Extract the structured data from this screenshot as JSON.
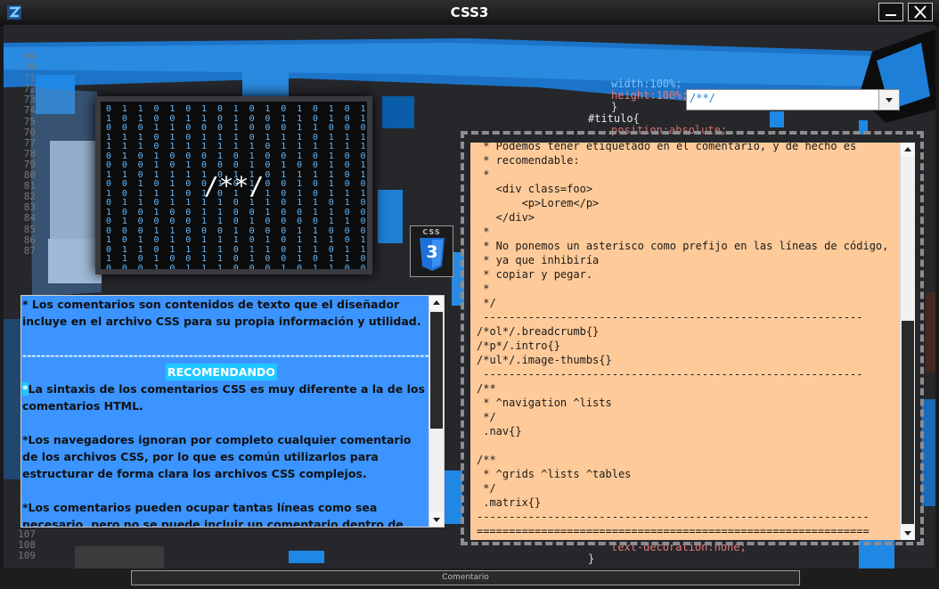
{
  "window": {
    "title": "CSS3",
    "app_icon": "z-logo-icon",
    "minimize_icon": "minimize-icon",
    "close_icon": "close-icon"
  },
  "background": {
    "line_numbers_top": [
      "69",
      "70",
      "71",
      "72",
      "73",
      "74",
      "75",
      "76",
      "77",
      "78",
      "79",
      "80",
      "81",
      "82",
      "83",
      "84",
      "85",
      "86",
      "87"
    ],
    "line_numbers_bottom": [
      "107",
      "108",
      "109"
    ],
    "code_top_right": [
      "width:100%;",
      "height:100%;",
      "}",
      "#titulo{",
      "position:absolute;"
    ],
    "code_bottom_right": [
      "text-decoration:none;",
      "}"
    ],
    "binary_rows": [
      "0 1 1 0 1 0 1 0 1 0 1 0 1 0 1 0 1 1 0 1 0",
      "1 0 1 0 0 1 1 0 1 0 0 1 1 0 1 0 1 0 0 1 1",
      "0 0 0 1 1 0 0 0 1 0 0 0 1 1 0 0 0 1 0 0 1",
      "1 1 1 0 1 0 1 1 1 0 1 1 1 0 1 1 1 0 1 0 1",
      "1 1 1 0 1 1 1 1 1 1 0 1 1 1 1 1 1 1 0 1 1",
      "0 1 0 1 0 0 0 1 0 1 0 0 1 0 1 0 0 0 1 0 1",
      "0 0 0 1 0 1 0 0 0 1 0 1 0 0 1 0 1 0 0 0 1",
      "1 1 0 1 1 1 1 0 1 1 0 1 1 1 1 0 1 1 1 0 1",
      "0 0 1 0 1 0 0 1 0 1 0 0 1 0 1 0 0 1 1 0 0",
      "1 0 1 1 1 0 1 0 1 1 1 0 1 0 1 1 1 0 1 1 0",
      "0 1 1 0 1 1 1 1 0 1 1 0 1 1 0 1 0 1 1 1 1",
      "1 0 0 1 0 0 1 1 0 0 1 0 0 1 1 0 0 1 0 0 1",
      "0 1 0 0 0 0 1 1 0 1 0 0 0 0 1 1 0 1 0 0 0",
      "0 0 0 1 1 0 0 0 1 0 0 0 1 1 0 0 0 1 0 0 0",
      "1 0 1 0 1 0 1 1 1 0 1 0 1 1 1 0 1 0 1 0 1",
      "0 1 1 0 1 1 1 1 0 1 1 0 1 1 0 1 1 1 1 0 1",
      "1 1 0 1 0 0 1 1 0 1 0 0 1 0 1 1 0 1 0 0 1",
      "0 0 0 1 0 1 1 1 0 0 0 1 0 1 1 0 0 1 0 0 0"
    ],
    "binary_overlay": "/**/",
    "css3_badge_text": "CSS",
    "css3_badge_number": "3"
  },
  "combo": {
    "value": "/**/"
  },
  "left_panel": {
    "intro": "* Los comentarios son contenidos de texto que el diseñador incluye en el archivo CSS para su propia información y utilidad.",
    "separator": "-------------------------------------------------------------------------------------------------------------",
    "heading": "RECOMENDANDO",
    "p1_star": "*",
    "p1": "La sintaxis de los comentarios CSS es muy diferente a la de los comentarios HTML.",
    "p2": "*Los navegadores ignoran por completo cualquier comentario de los archivos CSS, por lo que es común utilizarlos para estructurar de forma clara los archivos CSS complejos.",
    "p3": "*Los comentarios pueden ocupar tantas líneas como sea necesario, pero no se puede incluir un comentario dentro de otro comentario"
  },
  "right_panel": {
    "lines": [
      " * Podemos tener etiquetado en el comentario, y de hecho es",
      " * recomendable:",
      " *",
      "   <div class=foo>",
      "       <p>Lorem</p>",
      "   </div>",
      " *",
      " * No ponemos un asterisco como prefijo en las líneas de código,",
      " * ya que inhibiría",
      " * copiar y pegar.",
      " *",
      " */",
      " -----------------------------------------------------------",
      "/*ol*/.breadcrumb{}",
      "/*p*/.intro{}",
      "/*ul*/.image-thumbs{}",
      " -----------------------------------------------------------",
      "/**",
      " * ^navigation ^lists",
      " */",
      " .nav{}",
      "",
      "/**",
      " * ^grids ^lists ^tables",
      " */",
      " .matrix{}",
      "-------------------------------------------------------------",
      "============================================================="
    ]
  },
  "status": {
    "label": "Comentario"
  }
}
